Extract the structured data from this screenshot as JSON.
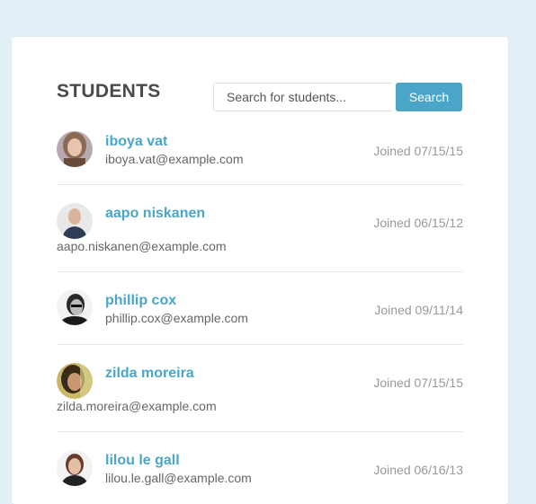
{
  "page": {
    "title": "STUDENTS"
  },
  "search": {
    "placeholder": "Search for students...",
    "button_label": "Search"
  },
  "colors": {
    "page_background": "#e3f0f7",
    "card_background": "#ffffff",
    "accent": "#4aa5c9",
    "divider": "#e8e8e8"
  },
  "students": [
    {
      "name": "iboya vat",
      "email": "iboya.vat@example.com",
      "joined": "Joined 07/15/15",
      "avatar": "avatar-photo"
    },
    {
      "name": "aapo niskanen",
      "email": "aapo.niskanen@example.com",
      "joined": "Joined 06/15/12",
      "avatar": "avatar-photo"
    },
    {
      "name": "phillip cox",
      "email": "phillip.cox@example.com",
      "joined": "Joined 09/11/14",
      "avatar": "avatar-photo"
    },
    {
      "name": "zilda moreira",
      "email": "zilda.moreira@example.com",
      "joined": "Joined 07/15/15",
      "avatar": "avatar-photo"
    },
    {
      "name": "lilou le gall",
      "email": "lilou.le.gall@example.com",
      "joined": "Joined 06/16/13",
      "avatar": "avatar-photo"
    }
  ]
}
